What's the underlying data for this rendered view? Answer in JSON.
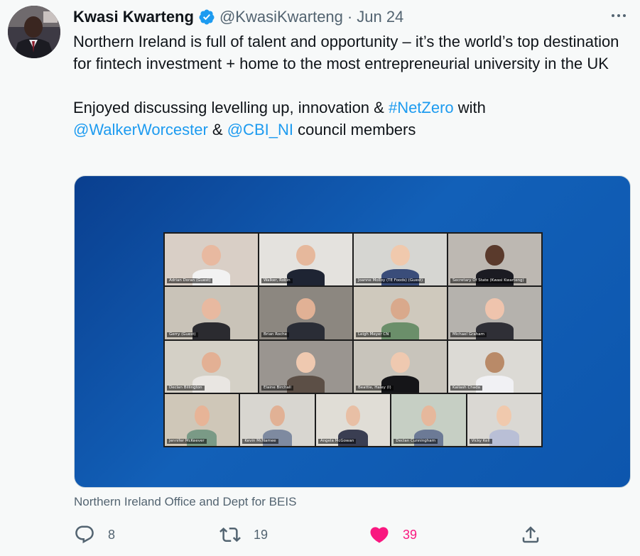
{
  "tweet": {
    "display_name": "Kwasi Kwarteng",
    "handle": "@KwasiKwarteng",
    "separator": "·",
    "date": "Jun 24",
    "paragraph1": "Northern Ireland is full of talent and opportunity – it’s the world’s top destination for fintech investment + home to the most entrepreneurial university in the UK",
    "p2_a": "Enjoyed discussing levelling up, innovation & ",
    "hashtag": "#NetZero",
    "p2_b": " with",
    "mention1": "@WalkerWorcester",
    "p2_c": " & ",
    "mention2": "@CBI_NI",
    "p2_d": " council members",
    "media_caption": "Northern Ireland Office and Dept for BEIS",
    "replies": "8",
    "retweets": "19",
    "likes": "39",
    "liked": true,
    "colors": {
      "link": "#1d9bf0",
      "like": "#f91880",
      "muted": "#536471",
      "verified": "#1d9bf0"
    }
  },
  "video_call": {
    "participants": [
      {
        "label": "Adrian Doran (Guest)"
      },
      {
        "label": "Walker, Robin"
      },
      {
        "label": "Joanne Molloy (TE Foods) (Guest)"
      },
      {
        "label": "Secretary Of State (Kwasi Kwarteng)"
      },
      {
        "label": "Gerry (Guest)"
      },
      {
        "label": "Brian Roche"
      },
      {
        "label": "Leigh Meyer CN"
      },
      {
        "label": "Michael Graham"
      },
      {
        "label": "Declan Billington"
      },
      {
        "label": "Elaine Birchall"
      },
      {
        "label": "Beattie, Haley (I)"
      },
      {
        "label": "Kailash Chada"
      },
      {
        "label": "Jennifer McKeever"
      },
      {
        "label": "Kevin McNamee"
      },
      {
        "label": "Angela McGowan"
      },
      {
        "label": "Declan Cunningham"
      },
      {
        "label": "Vicky Kell"
      }
    ]
  }
}
